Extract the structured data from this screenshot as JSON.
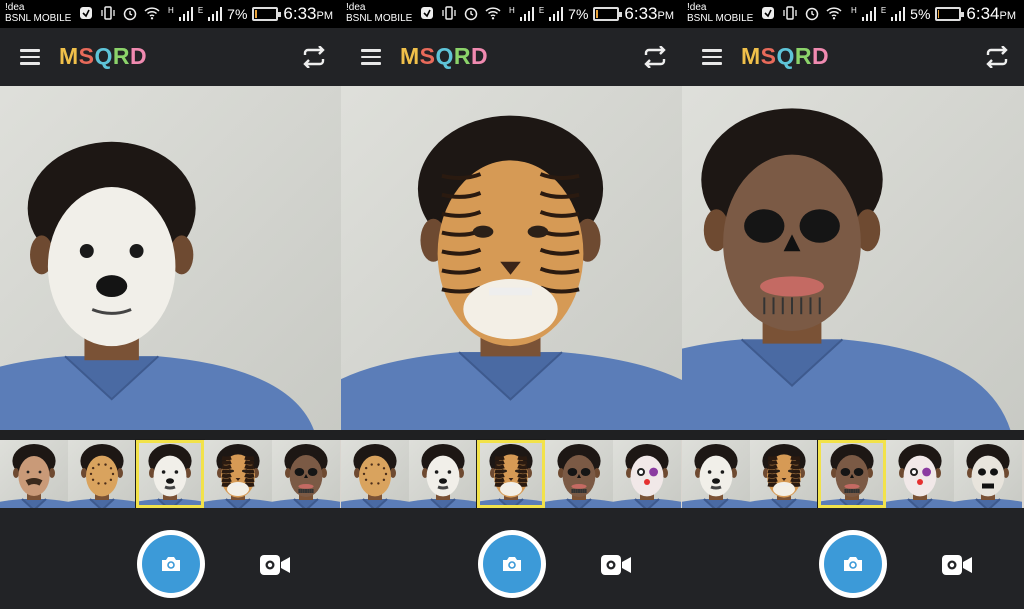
{
  "screens": [
    {
      "status": {
        "carrier_top": "!dea",
        "carrier_bottom": "BSNL MOBILE",
        "net1": "H",
        "net2": "E",
        "battery_pct": "7%",
        "battery_level": 0.07,
        "time": "6:33",
        "ampm": "PM"
      },
      "app": {
        "logo": "MSQRD"
      },
      "mask": "dog",
      "filters": [
        "none",
        "leopard",
        "dog",
        "tiger",
        "skull"
      ],
      "selected_filter": 2
    },
    {
      "status": {
        "carrier_top": "!dea",
        "carrier_bottom": "BSNL MOBILE",
        "net1": "H",
        "net2": "E",
        "battery_pct": "7%",
        "battery_level": 0.07,
        "time": "6:33",
        "ampm": "PM"
      },
      "app": {
        "logo": "MSQRD"
      },
      "mask": "tiger",
      "filters": [
        "leopard",
        "dog",
        "tiger",
        "skull",
        "clown"
      ],
      "selected_filter": 2
    },
    {
      "status": {
        "carrier_top": "!dea",
        "carrier_bottom": "BSNL MOBILE",
        "net1": "H",
        "net2": "E",
        "battery_pct": "5%",
        "battery_level": 0.05,
        "time": "6:34",
        "ampm": "PM"
      },
      "app": {
        "logo": "MSQRD"
      },
      "mask": "skull",
      "filters": [
        "dog",
        "tiger",
        "skull",
        "clown",
        "skeleton"
      ],
      "selected_filter": 2
    }
  ],
  "logo_colors": [
    "#f0c04a",
    "#e86a5a",
    "#5ec4d8",
    "#8bd36a",
    "#f08ab0"
  ],
  "colors": {
    "accent": "#3c9ad8",
    "selected_border": "#f2e24a",
    "bar": "#222326"
  },
  "icons": {
    "menu": "hamburger-icon",
    "switch": "camera-switch-icon",
    "shutter": "camera-icon",
    "video": "video-camera-icon"
  }
}
